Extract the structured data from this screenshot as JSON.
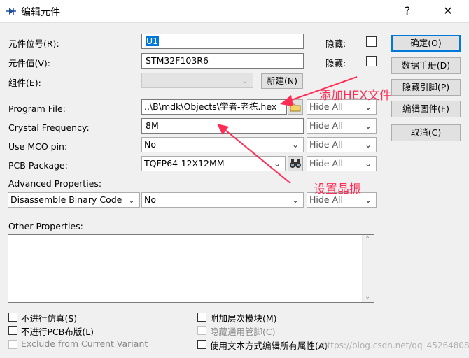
{
  "window": {
    "title": "编辑元件",
    "help": "?",
    "close": "✕"
  },
  "rows": {
    "ref": {
      "label": "元件位号(R):",
      "value": "U1",
      "hidden_label": "隐藏:"
    },
    "value": {
      "label": "元件值(V):",
      "value": "STM32F103R6",
      "hidden_label": "隐藏:"
    },
    "group": {
      "label": "组件(E):",
      "value": "",
      "new_button": "新建(N)"
    },
    "program_file": {
      "label": "Program File:",
      "value": "..\\B\\mdk\\Objects\\学者-老栋.hex",
      "hide": "Hide All"
    },
    "crystal": {
      "label": "Crystal Frequency:",
      "value": "8M",
      "hide": "Hide All"
    },
    "mco": {
      "label": "Use MCO pin:",
      "value": "No",
      "hide": "Hide All"
    },
    "pcb": {
      "label": "PCB Package:",
      "value": "TQFP64-12X12MM",
      "hide": "Hide All"
    }
  },
  "advanced": {
    "label": "Advanced Properties:",
    "property": "Disassemble Binary Code",
    "value": "No",
    "hide": "Hide All"
  },
  "other": {
    "label": "Other Properties:"
  },
  "options": {
    "no_sim": "不进行仿真(S)",
    "no_pcb": "不进行PCB布版(L)",
    "exclude_variant": "Exclude from Current Variant",
    "attach_hier": "附加层次模块(M)",
    "hide_pins": "隐藏通用管脚(C)",
    "edit_all_text": "使用文本方式编辑所有属性(A)"
  },
  "buttons": {
    "ok": "确定(O)",
    "datasheet": "数据手册(D)",
    "hidden_pins": "隐藏引脚(P)",
    "edit_firmware": "编辑固件(F)",
    "cancel": "取消(C)"
  },
  "annotations": {
    "hex": "添加HEX文件",
    "crystal": "设置晶振"
  },
  "watermark": "https://blog.csdn.net/qq_45264808",
  "colors": {
    "annotation": "#ff2d55",
    "selection": "#0078d7"
  }
}
